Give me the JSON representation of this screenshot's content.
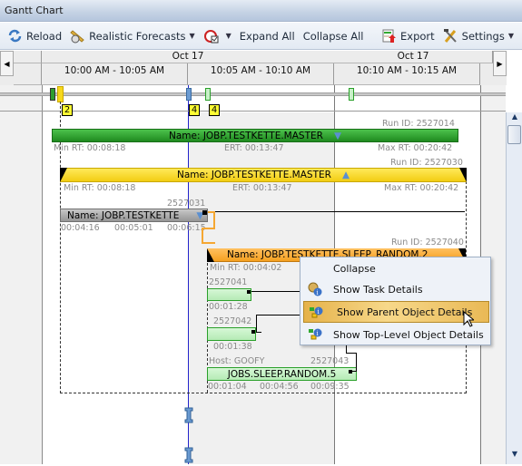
{
  "window": {
    "title": "Gantt Chart"
  },
  "toolbar": {
    "reload": "Reload",
    "forecasts": "Realistic Forecasts",
    "expand_all": "Expand All",
    "collapse_all": "Collapse All",
    "export": "Export",
    "settings": "Settings"
  },
  "timeline": {
    "dates": [
      "Oct 17",
      "Oct 17"
    ],
    "slots": [
      "10:00 AM - 10:05 AM",
      "10:05 AM - 10:10 AM",
      "10:10 AM - 10:15 AM"
    ]
  },
  "overview": {
    "badges": [
      "2",
      "4",
      "4"
    ]
  },
  "tasks": {
    "master1": {
      "run_id": "Run ID: 2527014",
      "name": "Name: JOBP.TESTKETTE.MASTER",
      "min_rt": "Min RT: 00:08:18",
      "ert": "ERT: 00:13:47",
      "max_rt": "Max RT: 00:20:42",
      "color": "#2e9e2e"
    },
    "master2": {
      "run_id": "Run ID: 2527030",
      "name": "Name: JOBP.TESTKETTE.MASTER",
      "min_rt": "Min RT: 00:08:18",
      "ert": "ERT: 00:13:47",
      "max_rt": "Max RT: 00:20:42",
      "color": "#f7d81c"
    },
    "testkette": {
      "run_id": "2527031",
      "name": "Name: JOBP.TESTKETTE",
      "t1": "00:04:16",
      "t2": "00:05:01",
      "t3": "00:06:15",
      "color": "#a0a0a0"
    },
    "sleep_random": {
      "run_id": "Run ID: 2527040",
      "name": "Name: JOBP.TESTKETTE.SLEEP_RANDOM.2",
      "min_rt": "Min RT: 00:04:02",
      "color": "#f5a732"
    },
    "job41": {
      "run_id": "2527041",
      "time": "00:01:28"
    },
    "job42": {
      "run_id": "2527042",
      "time": "00:01:38"
    },
    "job43": {
      "host": "Host: GOOFY",
      "run_id": "2527043",
      "name": "JOBS.SLEEP.RANDOM.5",
      "t1": "00:01:04",
      "t2": "00:04:56",
      "t3": "00:09:35"
    }
  },
  "context_menu": {
    "items": [
      "Collapse",
      "Show Task Details",
      "Show Parent Object Details",
      "Show Top-Level Object Details"
    ],
    "selected": "Show Parent Object Details"
  }
}
